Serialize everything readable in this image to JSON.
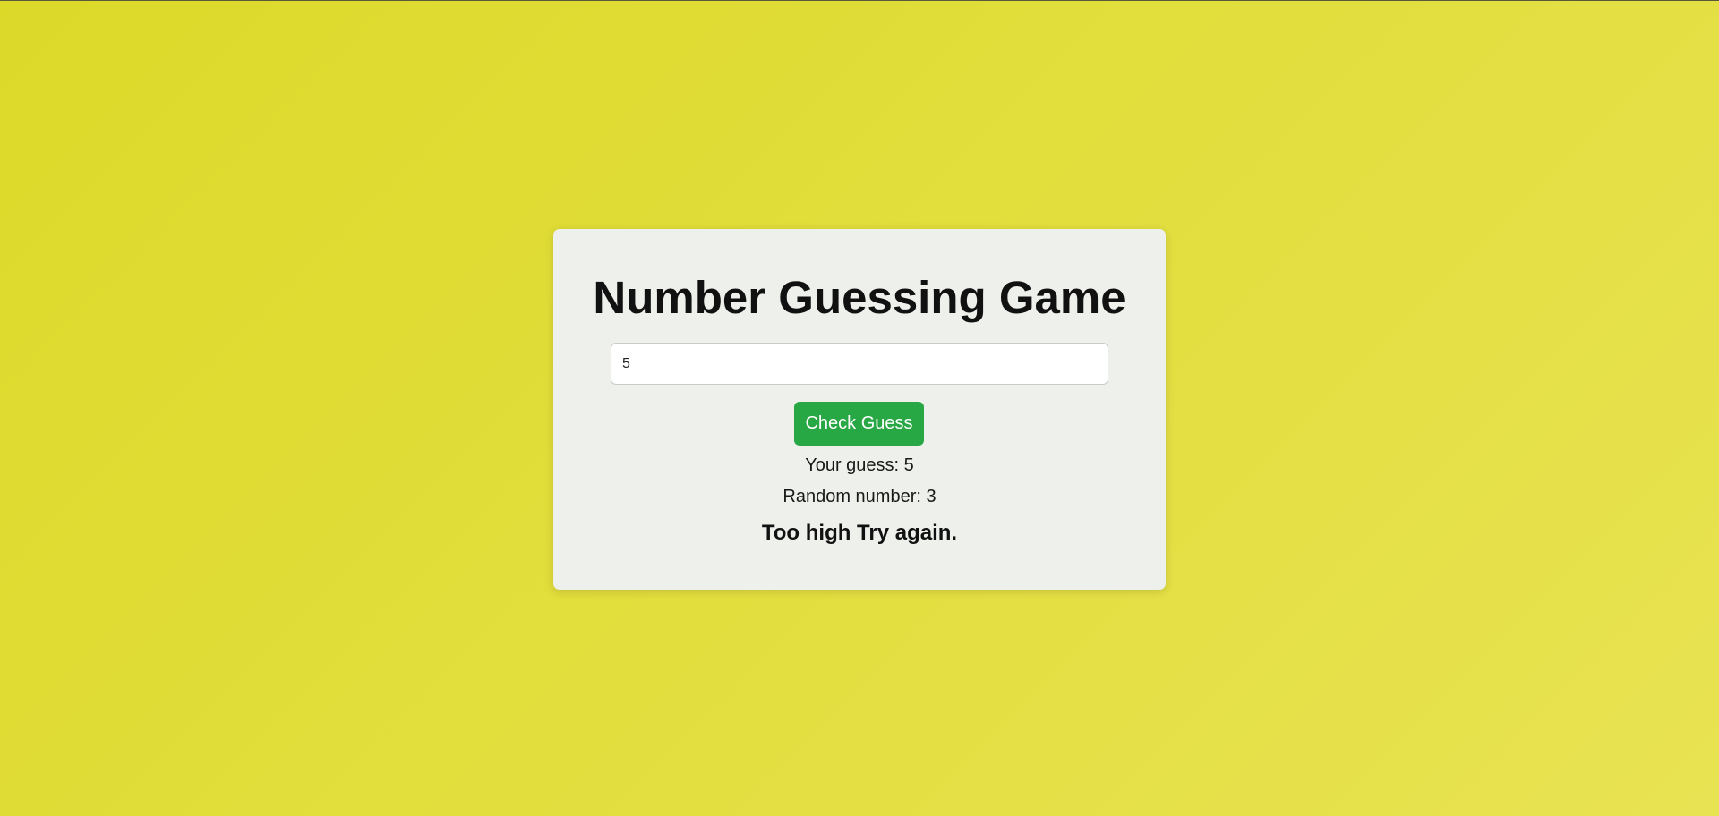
{
  "game": {
    "title": "Number Guessing Game",
    "input_value": "5",
    "check_button_label": "Check Guess",
    "your_guess_text": "Your guess: 5",
    "random_number_text": "Random number: 3",
    "result_text": "Too high Try again."
  },
  "colors": {
    "background_start": "#ddd929",
    "background_end": "#e8e352",
    "card_background": "#eef0eb",
    "button_green": "#28a745"
  }
}
